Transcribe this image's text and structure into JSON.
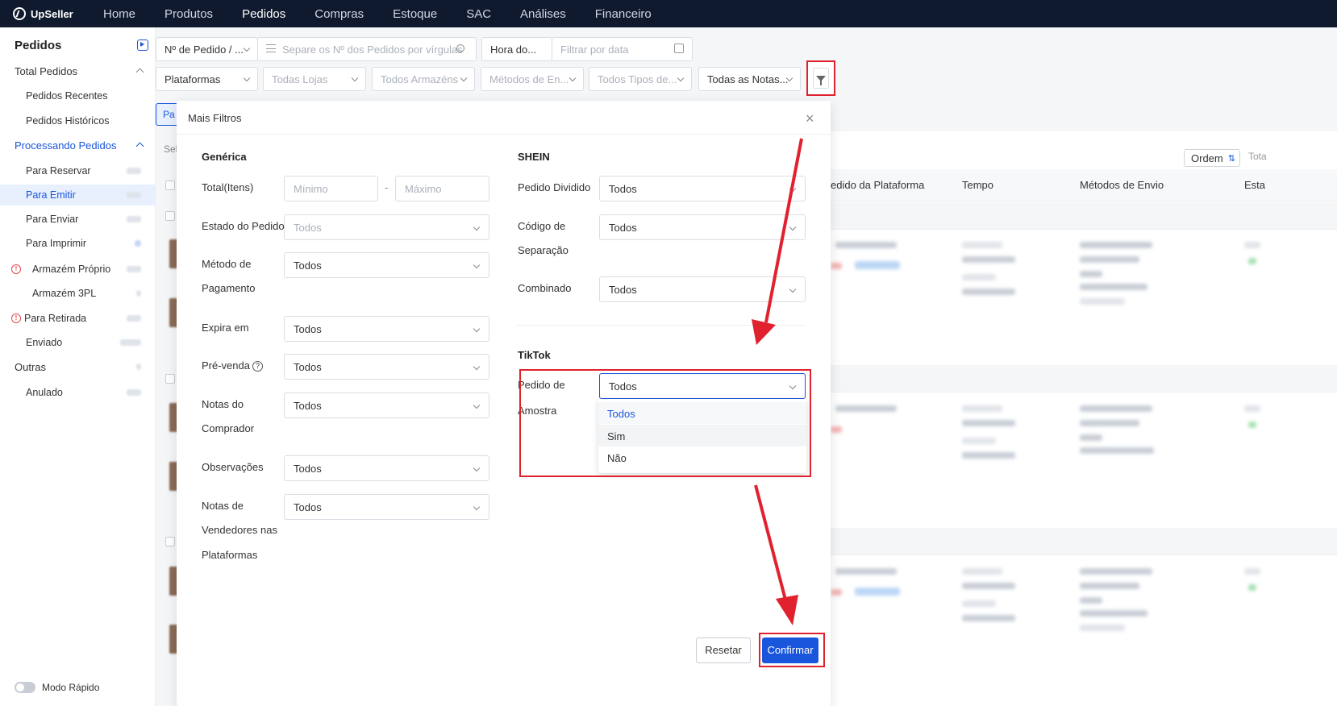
{
  "topnav": {
    "logo": "UpSeller",
    "items": [
      "Home",
      "Produtos",
      "Pedidos",
      "Compras",
      "Estoque",
      "SAC",
      "Análises",
      "Financeiro"
    ]
  },
  "sidebar": {
    "title": "Pedidos",
    "total_pedidos": "Total Pedidos",
    "pedidos_recentes": "Pedidos Recentes",
    "pedidos_historicos": "Pedidos Históricos",
    "processando": "Processando Pedidos",
    "para_reservar": "Para Reservar",
    "para_emitir": "Para Emitir",
    "para_enviar": "Para Enviar",
    "para_imprimir": "Para Imprimir",
    "armazem_proprio": "Armazém Próprio",
    "armazem_3pl": "Armazém 3PL",
    "para_retirada": "Para Retirada",
    "enviado": "Enviado",
    "outras": "Outras",
    "anulado": "Anulado",
    "modo_rapido": "Modo Rápido"
  },
  "filters": {
    "order_type": "Nº de Pedido / ...",
    "order_search_placeholder": "Separe os Nº dos Pedidos por vírgulas",
    "time_type": "Hora do...",
    "date_placeholder": "Filtrar por data",
    "platforms": "Plataformas",
    "stores": "Todas Lojas",
    "warehouses": "Todos Armazéns",
    "shipping_methods": "Métodos de En...",
    "types": "Todos Tipos de...",
    "notes": "Todas as Notas..."
  },
  "background": {
    "tab_partial": "Pa",
    "select_partial": "Sel",
    "ordem": "Ordem",
    "total_partial": "Tota",
    "columns": [
      "edido da Plataforma",
      "Tempo",
      "Métodos de Envio",
      "Esta"
    ]
  },
  "modal": {
    "title": "Mais Filtros",
    "generic": {
      "title": "Genérica",
      "total_label": "Total(Itens)",
      "min_placeholder": "Mínimo",
      "max_placeholder": "Máximo",
      "dash": "-",
      "estado_label": "Estado do Pedido",
      "estado_placeholder": "Todos",
      "metodo_label_1": "Método de",
      "metodo_label_2": "Pagamento",
      "metodo_value": "Todos",
      "expira_label": "Expira em",
      "expira_value": "Todos",
      "prevenda_label": "Pré-venda",
      "prevenda_value": "Todos",
      "notas_comprador_1": "Notas do",
      "notas_comprador_2": "Comprador",
      "notas_comprador_value": "Todos",
      "observacoes_label": "Observações",
      "observacoes_value": "Todos",
      "notas_vend_1": "Notas de",
      "notas_vend_2": "Vendedores nas",
      "notas_vend_3": "Plataformas",
      "notas_vend_value": "Todos"
    },
    "shein": {
      "title": "SHEIN",
      "dividido_label": "Pedido Dividido",
      "dividido_value": "Todos",
      "codigo_label_1": "Código de",
      "codigo_label_2": "Separação",
      "codigo_value": "Todos",
      "combinado_label": "Combinado",
      "combinado_value": "Todos"
    },
    "tiktok": {
      "title": "TikTok",
      "amostra_label_1": "Pedido de",
      "amostra_label_2": "Amostra",
      "amostra_value": "Todos",
      "options": [
        "Todos",
        "Sim",
        "Não"
      ]
    },
    "reset": "Resetar",
    "confirm": "Confirmar"
  },
  "colors": {
    "accent": "#1a56db",
    "annotation": "#e0222f",
    "nav_bg": "#0f1a2e"
  }
}
